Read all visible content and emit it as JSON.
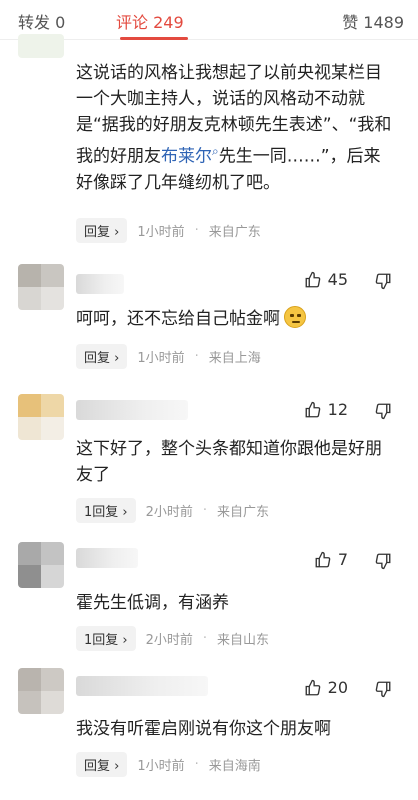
{
  "tabs": {
    "repost": "转发 0",
    "comment": "评论 249",
    "like": "赞 1489"
  },
  "colors": {
    "accent": "#e34a3f",
    "link": "#2f64b5"
  },
  "comments": [
    {
      "text_before": "这说话的风格让我想起了以前央视某栏目一个大咖主持人，说话的风格动不动就是“据我的好朋友克林顿先生表述”、“我和我的好朋友",
      "link": "布莱尔",
      "text_after": "先生一同……”，后来好像踩了几年缝纫机了吧。",
      "reply": "回复",
      "time": "1小时前",
      "location": "来自广东"
    },
    {
      "likes": "45",
      "text": "呵呵，还不忘给自己帖金啊",
      "emoji": "thinking-face",
      "reply": "回复",
      "time": "1小时前",
      "location": "来自上海"
    },
    {
      "likes": "12",
      "text": "这下好了，整个头条都知道你跟他是好朋友了",
      "reply": "1回复",
      "time": "2小时前",
      "location": "来自广东"
    },
    {
      "likes": "7",
      "text": "霍先生低调，有涵养",
      "reply": "1回复",
      "time": "2小时前",
      "location": "来自山东"
    },
    {
      "likes": "20",
      "text": "我没有听霍启刚说有你这个朋友啊",
      "reply": "回复",
      "time": "1小时前",
      "location": "来自海南"
    }
  ]
}
